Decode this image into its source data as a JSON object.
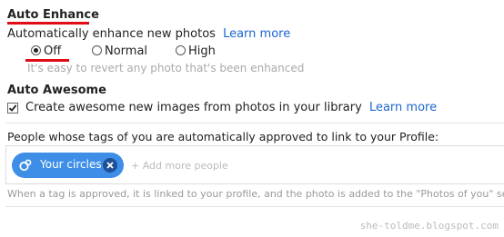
{
  "auto_enhance": {
    "title": "Auto Enhance",
    "description": "Automatically enhance new photos",
    "learn_more": "Learn more",
    "options": [
      {
        "label": "Off",
        "selected": true
      },
      {
        "label": "Normal",
        "selected": false
      },
      {
        "label": "High",
        "selected": false
      }
    ],
    "hint": "It's easy to revert any photo that's been enhanced"
  },
  "auto_awesome": {
    "title": "Auto Awesome",
    "checkbox_label": "Create awesome new images from photos in your library",
    "checked": true,
    "learn_more": "Learn more"
  },
  "tag_approval": {
    "description": "People whose tags of you are automatically approved to link to your Profile:",
    "chips": [
      {
        "label": "Your circles",
        "icon": "circles-icon"
      }
    ],
    "add_placeholder": "+ Add more people",
    "note": "When a tag is approved, it is linked to your profile, and the photo is added to the \"Photos of you\" secti"
  },
  "watermark": "she-toldme.blogspot.com",
  "colors": {
    "link": "#1a66cc",
    "chip": "#3e8ee8",
    "annotation": "#e10b17"
  }
}
